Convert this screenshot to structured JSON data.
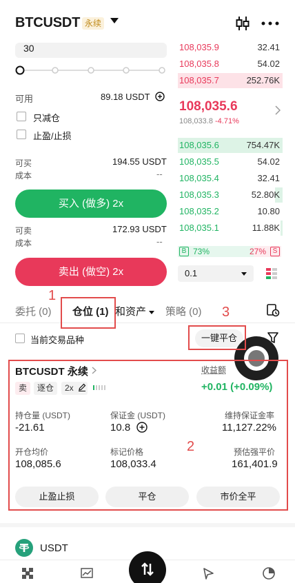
{
  "header": {
    "symbol": "BTCUSDT",
    "badge": "永续"
  },
  "order_form": {
    "quantity_value": "30",
    "available_label": "可用",
    "available_value": "89.18 USDT",
    "reduce_only_label": "只减仓",
    "tpsl_label": "止盈/止损",
    "buy_can_label": "可买",
    "buy_can_value": "194.55 USDT",
    "buy_cost_label": "成本",
    "buy_cost_value": "--",
    "buy_button": "买入 (做多) 2x",
    "sell_can_label": "可卖",
    "sell_can_value": "172.93 USDT",
    "sell_cost_label": "成本",
    "sell_cost_value": "--",
    "sell_button": "卖出 (做空) 2x"
  },
  "orderbook": {
    "asks": [
      {
        "price": "108,035.9",
        "qty": "32.41",
        "depth": 0
      },
      {
        "price": "108,035.8",
        "qty": "54.02",
        "depth": 0
      },
      {
        "price": "108,035.7",
        "qty": "252.76K",
        "depth": 1.0
      }
    ],
    "mid_price": "108,035.6",
    "mark_price": "108,033.8",
    "change": "-4.71%",
    "bids": [
      {
        "price": "108,035.6",
        "qty": "754.47K",
        "depth": 1.0
      },
      {
        "price": "108,035.5",
        "qty": "54.02",
        "depth": 0
      },
      {
        "price": "108,035.4",
        "qty": "32.41",
        "depth": 0
      },
      {
        "price": "108,035.3",
        "qty": "52.80K",
        "depth": 0.07
      },
      {
        "price": "108,035.2",
        "qty": "10.80",
        "depth": 0
      },
      {
        "price": "108,035.1",
        "qty": "11.88K",
        "depth": 0.02
      }
    ],
    "buy_ratio_label": "B",
    "buy_ratio": "73%",
    "sell_ratio": "27%",
    "sell_ratio_label": "S",
    "tick_size": "0.1"
  },
  "tabs": {
    "orders": "委托 (0)",
    "positions": "仓位 (1)",
    "assets": "和资产",
    "strategy": "策略 (0)"
  },
  "filter": {
    "current_symbol_label": "当前交易品种",
    "close_all_button": "一键平仓"
  },
  "position": {
    "symbol": "BTCUSDT 永续",
    "side": "卖",
    "margin_mode": "逐仓",
    "leverage": "2x",
    "pnl_label": "收益额",
    "pnl_value": "+0.01 (+0.09%)",
    "size_label": "持仓量 (USDT)",
    "size_value": "-21.61",
    "margin_label": "保证金 (USDT)",
    "margin_value": "10.8",
    "maint_label": "维持保证金率",
    "maint_value": "11,127.22%",
    "entry_label": "开仓均价",
    "entry_value": "108,085.6",
    "mark_label": "标记价格",
    "mark_value": "108,033.4",
    "liq_label": "预估强平价",
    "liq_value": "161,401.9",
    "tpsl_button": "止盈止损",
    "close_button": "平仓",
    "market_close_button": "市价全平"
  },
  "annotations": {
    "one": "1",
    "two": "2",
    "three": "3"
  },
  "asset_row": {
    "coin": "USDT"
  }
}
